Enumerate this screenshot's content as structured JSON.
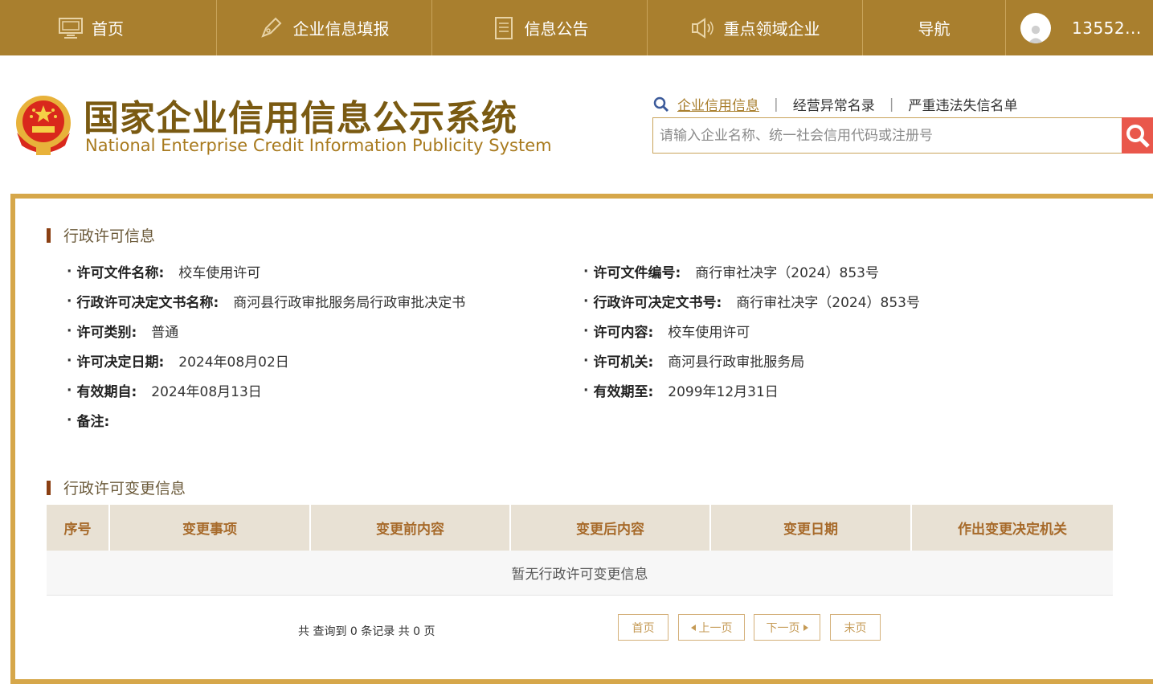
{
  "nav": {
    "home": "首页",
    "fill": "企业信息填报",
    "notice": "信息公告",
    "key_field": "重点领域企业",
    "guide": "导航",
    "user": "13552..."
  },
  "header": {
    "title_cn": "国家企业信用信息公示系统",
    "title_en": "National Enterprise Credit Information Publicity System",
    "links": [
      "企业信用信息",
      "经营异常名录",
      "严重违法失信名单"
    ],
    "separator": "|",
    "search_placeholder": "请输入企业名称、统一社会信用代码或注册号"
  },
  "permit": {
    "section_title": "行政许可信息",
    "left": [
      {
        "label": "许可文件名称:",
        "value": "校车使用许可"
      },
      {
        "label": "行政许可决定文书名称:",
        "value": "商河县行政审批服务局行政审批决定书"
      },
      {
        "label": "许可类别:",
        "value": "普通"
      },
      {
        "label": "许可决定日期:",
        "value": "2024年08月02日"
      },
      {
        "label": "有效期自:",
        "value": "2024年08月13日"
      },
      {
        "label": "备注:",
        "value": ""
      }
    ],
    "right": [
      {
        "label": "许可文件编号:",
        "value": "商行审社决字（2024）853号"
      },
      {
        "label": "行政许可决定文书号:",
        "value": "商行审社决字（2024）853号"
      },
      {
        "label": "许可内容:",
        "value": "校车使用许可"
      },
      {
        "label": "许可机关:",
        "value": "商河县行政审批服务局"
      },
      {
        "label": "有效期至:",
        "value": "2099年12月31日"
      }
    ],
    "bullet": "·"
  },
  "change": {
    "section_title": "行政许可变更信息",
    "columns": [
      "序号",
      "变更事项",
      "变更前内容",
      "变更后内容",
      "变更日期",
      "作出变更决定机关"
    ],
    "empty_text": "暂无行政许可变更信息"
  },
  "pager": {
    "info": "共 查询到 0 条记录 共 0 页",
    "first": "首页",
    "prev": "上一页",
    "next": "下一页",
    "last": "末页"
  },
  "colors": {
    "nav_bg": "#a97f2e",
    "frame_border": "#d6a74a",
    "title_brown": "#7a5a12",
    "search_btn": "#e9574b",
    "table_head": "#e8e1d4"
  }
}
